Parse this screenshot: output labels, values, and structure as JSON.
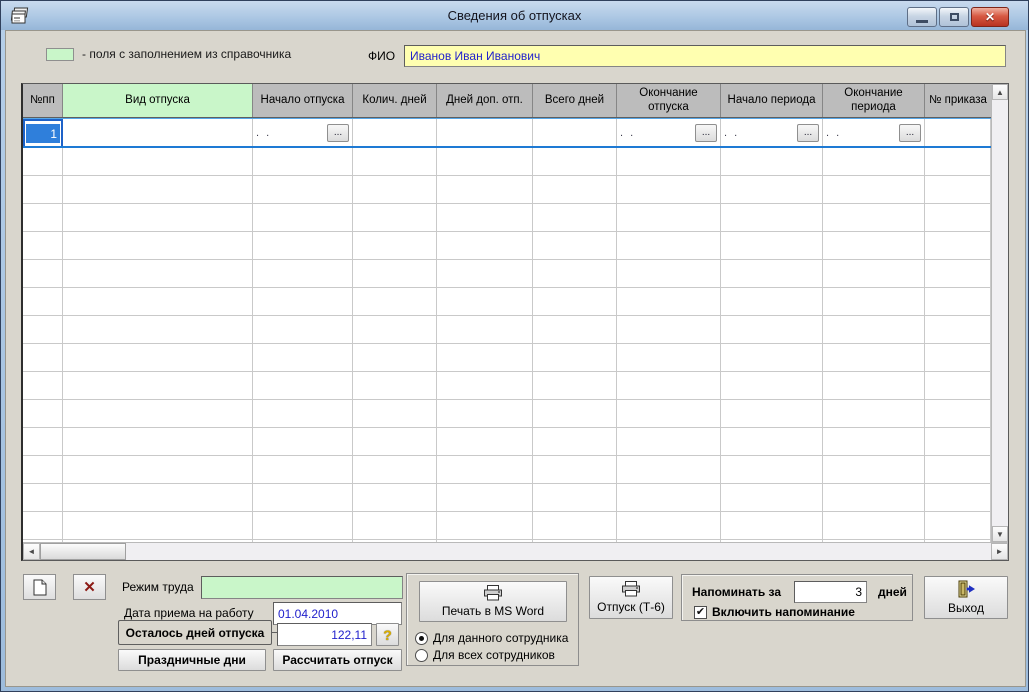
{
  "window": {
    "title": "Сведения об отпусках"
  },
  "icons": {
    "close": "✕",
    "check": "✔",
    "help": "?",
    "delete": "✕",
    "up_arrow": "▲",
    "down_arrow": "▼",
    "left_arrow": "◄",
    "right_arrow": "►",
    "ellipsis": "..."
  },
  "legend": {
    "text": "- поля с заполнением из справочника",
    "swatch_color": "#c9f6c9"
  },
  "fio": {
    "label": "ФИО",
    "value": "Иванов Иван Иванович"
  },
  "table": {
    "columns": [
      "№пп",
      "Вид отпуска",
      "Начало отпуска",
      "Колич. дней",
      "Дней доп. отп.",
      "Всего дней",
      "Окончание отпуска",
      "Начало периода",
      "Окончание периода",
      "№ приказа"
    ],
    "row1": {
      "num": "1",
      "date_placeholder": ".  .",
      "ellipsis": "..."
    },
    "empty_row_count": 16
  },
  "controls": {
    "work_mode_label": "Режим труда",
    "work_mode_value": "",
    "hire_date_label": "Дата приема на работу",
    "hire_date_value": "01.04.2010",
    "days_left_label": "Осталось дней отпуска",
    "days_left_value": "122,11",
    "holidays_button": "Праздничные дни",
    "calculate_button": "Рассчитать отпуск"
  },
  "print": {
    "word_button": "Печать в MS Word",
    "radio_current_employee": "Для данного сотрудника",
    "radio_all_employees": "Для всех сотрудников",
    "t6_button": "Отпуск (Т-6)"
  },
  "reminder": {
    "remind_label": "Напоминать за",
    "days_value": "3",
    "days_label": "дней",
    "enable_label": "Включить напоминание",
    "enabled": true
  },
  "exit": {
    "label": "Выход"
  },
  "colors": {
    "selection_blue": "#2f7fdb",
    "value_blue": "#2222cc",
    "field_yellow": "#ffffb0",
    "field_green": "#c9f6c9"
  }
}
